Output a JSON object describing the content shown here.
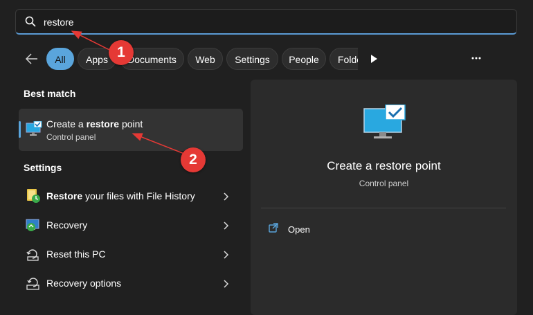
{
  "search": {
    "value": "restore",
    "icon": "search-icon"
  },
  "filters": {
    "back_icon": "arrow-left-icon",
    "chips": [
      "All",
      "Apps",
      "Documents",
      "Web",
      "Settings",
      "People",
      "Folders"
    ],
    "active": "All",
    "scroll_icon": "play-icon",
    "more_icon": "more-icon"
  },
  "best_match": {
    "heading": "Best match",
    "item": {
      "title_prefix": "Create a ",
      "title_bold": "restore",
      "title_suffix": " point",
      "subtitle": "Control panel",
      "icon": "monitor-check-icon"
    }
  },
  "settings": {
    "heading": "Settings",
    "items": [
      {
        "label_bold": "Restore",
        "label_rest": " your files with File History",
        "icon": "file-history-icon"
      },
      {
        "label_bold": "",
        "label_rest": "Recovery",
        "icon": "recovery-icon"
      },
      {
        "label_bold": "",
        "label_rest": "Reset this PC",
        "icon": "reset-pc-icon"
      },
      {
        "label_bold": "",
        "label_rest": "Recovery options",
        "icon": "recovery-options-icon"
      }
    ]
  },
  "preview": {
    "title": "Create a restore point",
    "subtitle": "Control panel",
    "open_label": "Open",
    "icon": "monitor-check-icon"
  },
  "annotations": [
    "1",
    "2"
  ],
  "colors": {
    "accent": "#5aa5dc",
    "callout": "#e53935",
    "background": "#202020",
    "panel": "#2b2b2b"
  }
}
